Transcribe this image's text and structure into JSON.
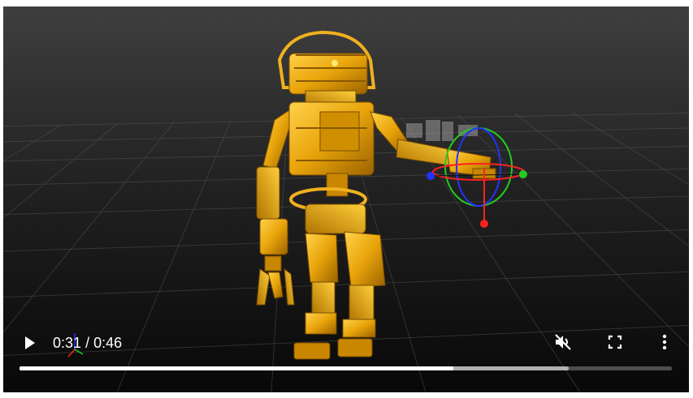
{
  "player": {
    "current_time": "0:31",
    "separator": "/",
    "duration": "0:46",
    "played_fraction": 0.665,
    "buffered_fraction": 0.842,
    "muted": true
  },
  "icons": {
    "play": "play-icon",
    "mute": "volume-muted-icon",
    "fullscreen": "fullscreen-icon",
    "more": "more-vert-icon"
  },
  "colors": {
    "robot_gold": "#e8a40a",
    "gizmo_red": "#ff2020",
    "gizmo_green": "#22cc22",
    "gizmo_blue": "#2233ff",
    "progress_played": "#ffffff"
  }
}
